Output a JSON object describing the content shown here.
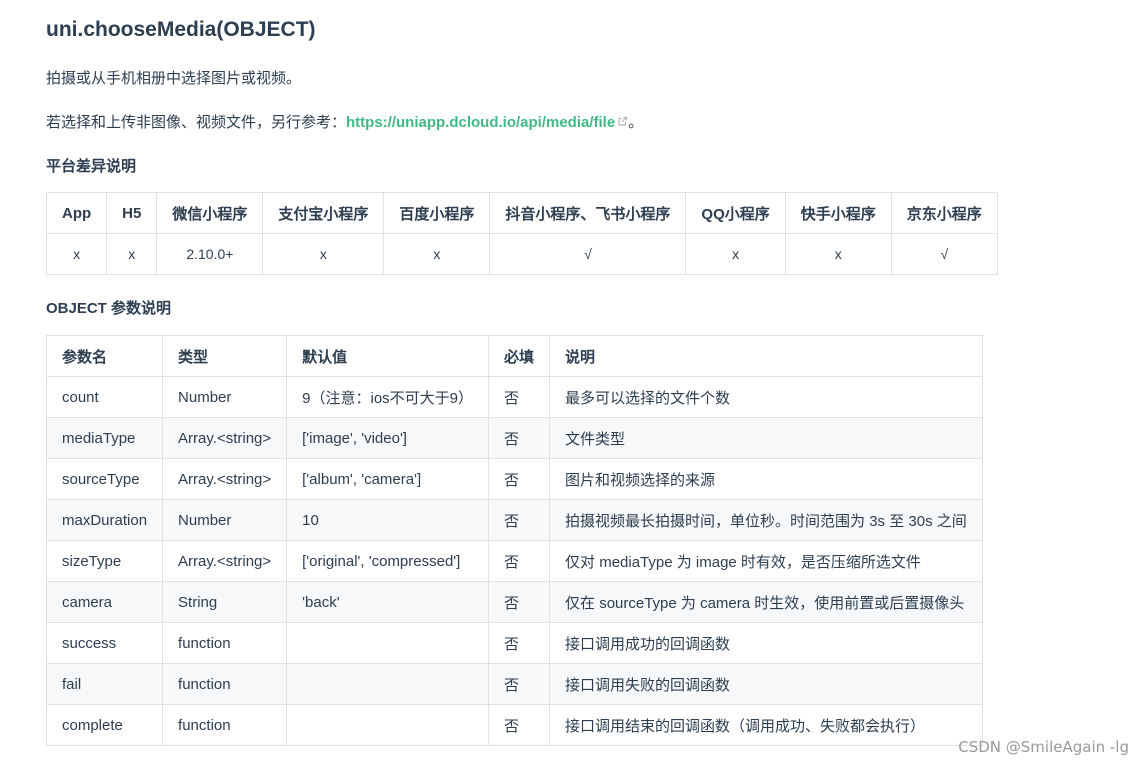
{
  "title": "uni.chooseMedia(OBJECT)",
  "description": "拍摄或从手机相册中选择图片或视频。",
  "ref_prefix": "若选择和上传非图像、视频文件，另行参考：",
  "ref_link": "https://uniapp.dcloud.io/api/media/file",
  "ref_suffix": "。",
  "platform_heading": "平台差异说明",
  "platform_table": {
    "headers": [
      "App",
      "H5",
      "微信小程序",
      "支付宝小程序",
      "百度小程序",
      "抖音小程序、飞书小程序",
      "QQ小程序",
      "快手小程序",
      "京东小程序"
    ],
    "values": [
      "x",
      "x",
      "2.10.0+",
      "x",
      "x",
      "√",
      "x",
      "x",
      "√"
    ]
  },
  "object_heading": "OBJECT 参数说明",
  "params_table": {
    "headers": [
      "参数名",
      "类型",
      "默认值",
      "必填",
      "说明"
    ],
    "rows": [
      [
        "count",
        "Number",
        "9（注意：ios不可大于9）",
        "否",
        "最多可以选择的文件个数"
      ],
      [
        "mediaType",
        "Array.<string>",
        "['image', 'video']",
        "否",
        "文件类型"
      ],
      [
        "sourceType",
        "Array.<string>",
        "['album', 'camera']",
        "否",
        "图片和视频选择的来源"
      ],
      [
        "maxDuration",
        "Number",
        "10",
        "否",
        "拍摄视频最长拍摄时间，单位秒。时间范围为 3s 至 30s 之间"
      ],
      [
        "sizeType",
        "Array.<string>",
        "['original', 'compressed']",
        "否",
        "仅对 mediaType 为 image 时有效，是否压缩所选文件"
      ],
      [
        "camera",
        "String",
        "'back'",
        "否",
        "仅在 sourceType 为 camera 时生效，使用前置或后置摄像头"
      ],
      [
        "success",
        "function",
        "",
        "否",
        "接口调用成功的回调函数"
      ],
      [
        "fail",
        "function",
        "",
        "否",
        "接口调用失败的回调函数"
      ],
      [
        "complete",
        "function",
        "",
        "否",
        "接口调用结束的回调函数（调用成功、失败都会执行）"
      ]
    ]
  },
  "watermark": "CSDN @SmileAgain -lg",
  "colors": {
    "link": "#42b983",
    "text": "#2c3e50",
    "border": "#dfe2e5",
    "stripe": "#f6f8fa"
  },
  "icons": {
    "external_link": "external-link-icon"
  }
}
